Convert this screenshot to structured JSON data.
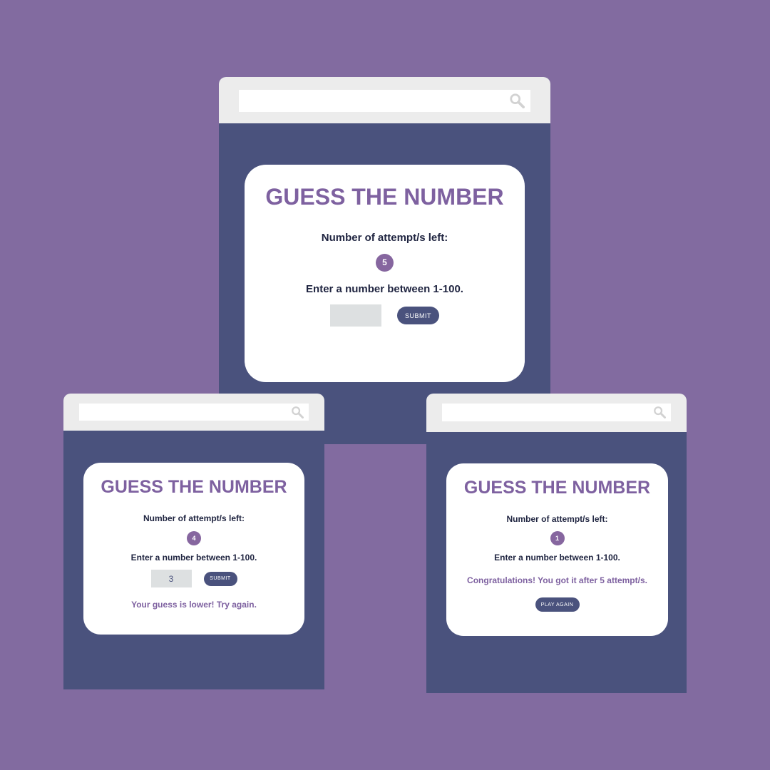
{
  "colors": {
    "background": "#826ba0",
    "window_body": "#4a527d",
    "chrome": "#ececec",
    "title": "#7e61a0",
    "badge": "#86669f",
    "button": "#4a527d",
    "input": "#dde0e1",
    "text": "#1f2440"
  },
  "icons": {
    "search": "search-icon"
  },
  "windows": [
    {
      "search": {
        "placeholder": ""
      },
      "title": "GUESS THE NUMBER",
      "attempts_label": "Number of attempt/s left:",
      "attempts_left": "5",
      "prompt": "Enter a number between 1-100.",
      "input_value": "",
      "submit_label": "SUBMIT"
    },
    {
      "search": {
        "placeholder": ""
      },
      "title": "GUESS THE NUMBER",
      "attempts_label": "Number of attempt/s left:",
      "attempts_left": "4",
      "prompt": "Enter a number between 1-100.",
      "input_value": "3",
      "submit_label": "SUBMIT",
      "message": "Your guess is lower! Try again."
    },
    {
      "search": {
        "placeholder": ""
      },
      "title": "GUESS THE NUMBER",
      "attempts_label": "Number of attempt/s left:",
      "attempts_left": "1",
      "prompt": "Enter a number between 1-100.",
      "message": "Congratulations! You got it after 5 attempt/s.",
      "play_again_label": "PLAY AGAIN"
    }
  ]
}
